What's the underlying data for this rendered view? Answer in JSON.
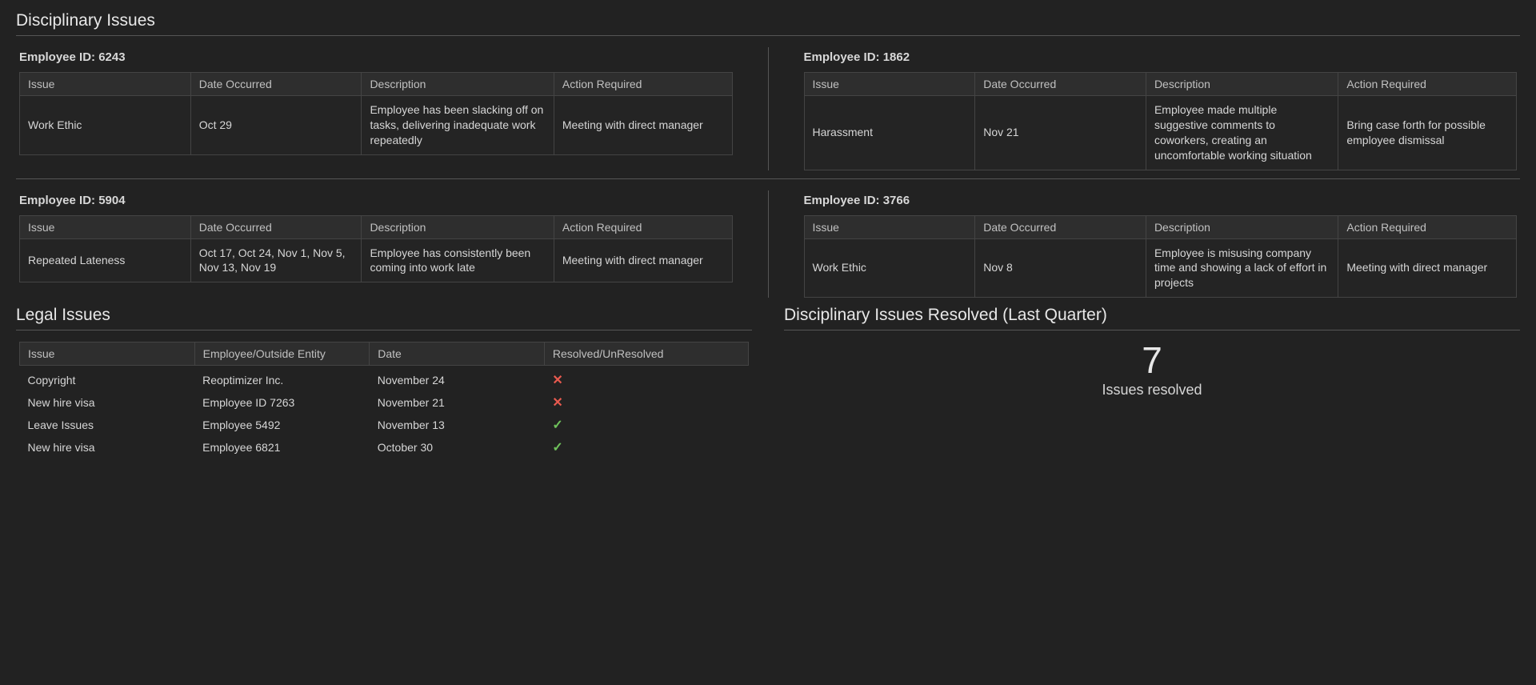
{
  "disciplinary": {
    "title": "Disciplinary Issues",
    "headers": {
      "issue": "Issue",
      "date": "Date Occurred",
      "desc": "Description",
      "action": "Action Required"
    },
    "emp_label": "Employee ID:",
    "employees": [
      {
        "id": "6243",
        "issue": "Work Ethic",
        "date": "Oct 29",
        "desc": "Employee has been slacking off on tasks, delivering inadequate work repeatedly",
        "action": "Meeting with direct manager"
      },
      {
        "id": "1862",
        "issue": "Harassment",
        "date": "Nov 21",
        "desc": "Employee made multiple suggestive comments to coworkers, creating an uncomfortable working situation",
        "action": "Bring case forth for possible employee dismissal"
      },
      {
        "id": "5904",
        "issue": "Repeated Lateness",
        "date": "Oct 17, Oct 24, Nov 1, Nov 5, Nov 13, Nov 19",
        "desc": "Employee has consistently been coming into work late",
        "action": "Meeting with direct manager"
      },
      {
        "id": "3766",
        "issue": "Work Ethic",
        "date": "Nov 8",
        "desc": "Employee is misusing company time and showing a lack of effort in projects",
        "action": "Meeting with direct manager"
      }
    ]
  },
  "legal": {
    "title": "Legal Issues",
    "headers": {
      "issue": "Issue",
      "entity": "Employee/Outside Entity",
      "date": "Date",
      "status": "Resolved/UnResolved"
    },
    "rows": [
      {
        "issue": "Copyright",
        "entity": "Reoptimizer Inc.",
        "date": "November 24",
        "resolved": false
      },
      {
        "issue": "New hire visa",
        "entity": "Employee ID 7263",
        "date": "November 21",
        "resolved": false
      },
      {
        "issue": "Leave Issues",
        "entity": "Employee 5492",
        "date": "November 13",
        "resolved": true
      },
      {
        "issue": "New hire visa",
        "entity": "Employee 6821",
        "date": "October 30",
        "resolved": true
      }
    ]
  },
  "resolved": {
    "title": "Disciplinary Issues Resolved (Last Quarter)",
    "count": "7",
    "label": "Issues resolved"
  }
}
